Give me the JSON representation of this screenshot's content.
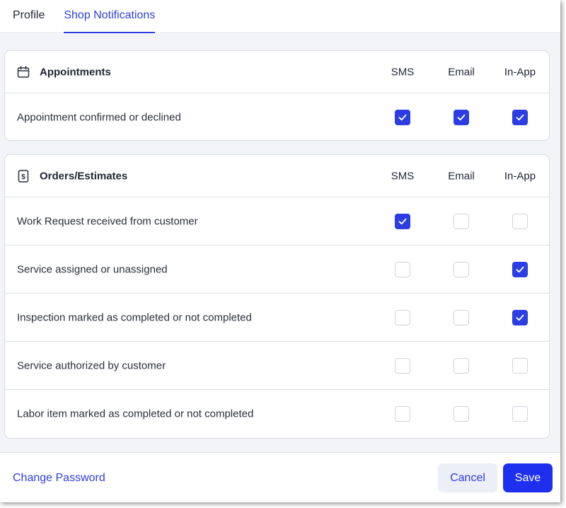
{
  "tabs": [
    {
      "label": "Profile",
      "active": false
    },
    {
      "label": "Shop Notifications",
      "active": true
    }
  ],
  "columns": {
    "sms": "SMS",
    "email": "Email",
    "in_app": "In-App"
  },
  "sections": [
    {
      "title": "Appointments",
      "icon": "calendar-icon",
      "rows": [
        {
          "label": "Appointment confirmed or declined",
          "sms": true,
          "email": true,
          "in_app": true
        }
      ]
    },
    {
      "title": "Orders/Estimates",
      "icon": "dollar-document-icon",
      "rows": [
        {
          "label": "Work Request received from customer",
          "sms": true,
          "email": false,
          "in_app": false
        },
        {
          "label": "Service assigned or unassigned",
          "sms": false,
          "email": false,
          "in_app": true
        },
        {
          "label": "Inspection marked as completed or not completed",
          "sms": false,
          "email": false,
          "in_app": true
        },
        {
          "label": "Service authorized by customer",
          "sms": false,
          "email": false,
          "in_app": false
        },
        {
          "label": "Labor item marked as completed or not completed",
          "sms": false,
          "email": false,
          "in_app": false
        }
      ]
    }
  ],
  "footer": {
    "change_password_label": "Change Password",
    "cancel_label": "Cancel",
    "save_label": "Save"
  },
  "colors": {
    "accent": "#2f3de0",
    "checkbox_checked": "#2b3de3",
    "background": "#f3f4f8"
  }
}
